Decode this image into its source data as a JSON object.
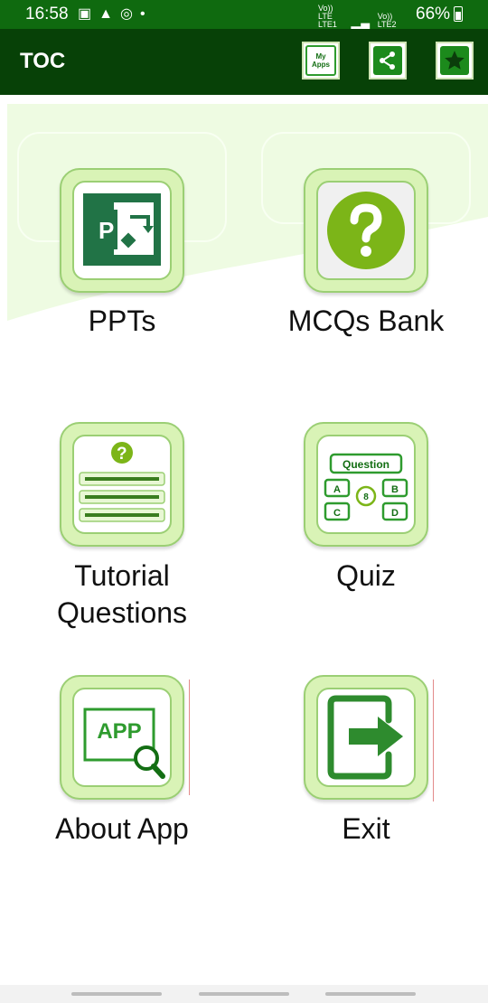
{
  "status_bar": {
    "time": "16:58",
    "notification_icons": [
      "image-icon",
      "alert-icon",
      "sync-icon",
      "dot-icon"
    ],
    "sim1_label": "Vo)) LTE LTE1",
    "sim2_label": "Vo)) LTE2",
    "battery": "66%"
  },
  "app_bar": {
    "title": "TOC",
    "my_apps_label": "My\nApps",
    "actions": [
      "my-apps-icon",
      "share-icon",
      "star-icon"
    ]
  },
  "colors": {
    "status_bar": "#0f6a0f",
    "app_bar": "#074107",
    "tile_bg": "#d9f3b6",
    "tile_border": "#9bcf74",
    "accent_green": "#1c8a1c",
    "lime": "#7cb518"
  },
  "menu": {
    "ppts": "PPTs",
    "mcqs": "MCQs Bank",
    "tutorial": "Tutorial\nQuestions",
    "quiz": "Quiz",
    "about": "About App",
    "exit": "Exit"
  },
  "quiz_icon": {
    "question": "Question",
    "a": "A",
    "b": "B",
    "c": "C",
    "d": "D",
    "timer": "8"
  },
  "about_icon": {
    "app": "APP"
  },
  "ppt_icon": {
    "letter": "P"
  }
}
